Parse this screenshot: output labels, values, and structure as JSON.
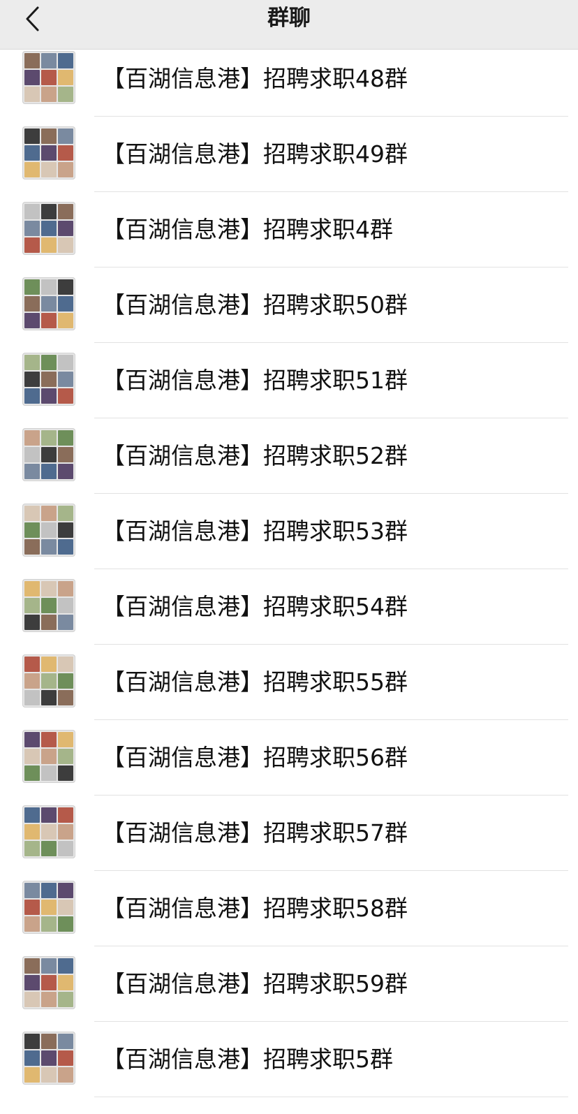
{
  "navbar": {
    "title": "群聊",
    "back_icon": "chevron-left-icon"
  },
  "groups": [
    {
      "name": "【百湖信息港】招聘求职48群"
    },
    {
      "name": "【百湖信息港】招聘求职49群"
    },
    {
      "name": "【百湖信息港】招聘求职4群"
    },
    {
      "name": "【百湖信息港】招聘求职50群"
    },
    {
      "name": "【百湖信息港】招聘求职51群"
    },
    {
      "name": "【百湖信息港】招聘求职52群"
    },
    {
      "name": "【百湖信息港】招聘求职53群"
    },
    {
      "name": "【百湖信息港】招聘求职54群"
    },
    {
      "name": "【百湖信息港】招聘求职55群"
    },
    {
      "name": "【百湖信息港】招聘求职56群"
    },
    {
      "name": "【百湖信息港】招聘求职57群"
    },
    {
      "name": "【百湖信息港】招聘求职58群"
    },
    {
      "name": "【百湖信息港】招聘求职59群"
    },
    {
      "name": "【百湖信息港】招聘求职5群"
    }
  ]
}
